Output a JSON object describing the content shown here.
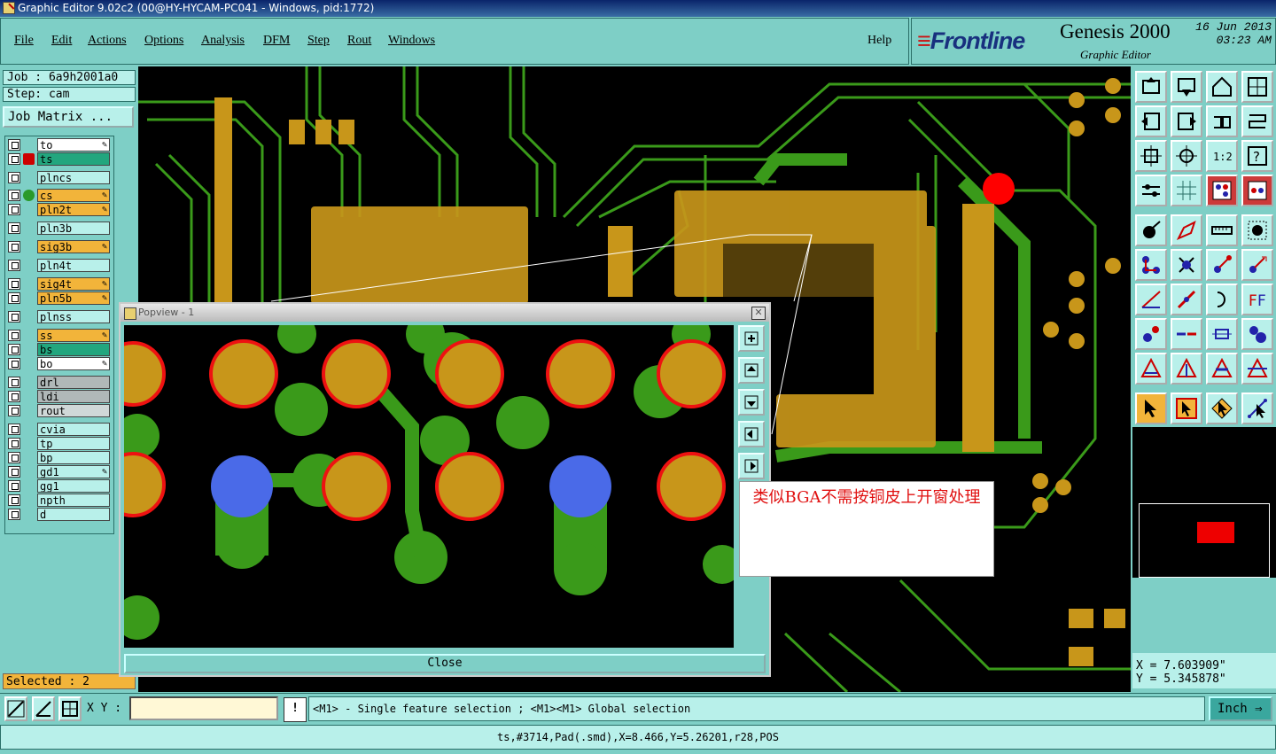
{
  "window": {
    "title": "Graphic Editor 9.02c2 (00@HY-HYCAM-PC041 - Windows, pid:1772)"
  },
  "menu": {
    "items": [
      "File",
      "Edit",
      "Actions",
      "Options",
      "Analysis",
      "DFM",
      "Step",
      "Rout",
      "Windows"
    ],
    "help": "Help"
  },
  "brand": {
    "logo": "Frontline",
    "product": "Genesis 2000",
    "subtitle": "Graphic Editor",
    "date": "16 Jun 2013",
    "time": "03:23 AM"
  },
  "job": {
    "job_label": "Job : 6a9h2001a0",
    "step_label": "Step: cam",
    "matrix_button": "Job Matrix ..."
  },
  "layers": [
    {
      "name": "to",
      "color": "#ffffff"
    },
    {
      "name": "ts",
      "color": "#22a67e"
    },
    {
      "name": "plncs",
      "color": "#b8f0ea"
    },
    {
      "name": "cs",
      "color": "#f2b43a"
    },
    {
      "name": "pln2t",
      "color": "#f2b43a"
    },
    {
      "name": "pln3b",
      "color": "#b8f0ea"
    },
    {
      "name": "sig3b",
      "color": "#f2b43a"
    },
    {
      "name": "pln4t",
      "color": "#b8f0ea"
    },
    {
      "name": "sig4t",
      "color": "#f2b43a"
    },
    {
      "name": "pln5b",
      "color": "#f2b43a"
    },
    {
      "name": "plnss",
      "color": "#b8f0ea"
    },
    {
      "name": "ss",
      "color": "#f2b43a"
    },
    {
      "name": "bs",
      "color": "#22a67e"
    },
    {
      "name": "bo",
      "color": "#ffffff"
    },
    {
      "name": "drl",
      "color": "#b0b8b8"
    },
    {
      "name": "ldi",
      "color": "#b0b8b8"
    },
    {
      "name": "rout",
      "color": "#d0d8d8"
    },
    {
      "name": "cvia",
      "color": "#b8f0ea"
    },
    {
      "name": "tp",
      "color": "#b8f0ea"
    },
    {
      "name": "bp",
      "color": "#b8f0ea"
    },
    {
      "name": "gd1",
      "color": "#b8f0ea"
    },
    {
      "name": "gg1",
      "color": "#b8f0ea"
    },
    {
      "name": "npth",
      "color": "#b8f0ea"
    },
    {
      "name": "d",
      "color": "#b8f0ea"
    }
  ],
  "selection": {
    "label": "Selected : 2"
  },
  "popview": {
    "title": "Popview - 1",
    "close_label": "Close"
  },
  "annotation": {
    "text": "类似BGA不需按铜皮上开窗处理"
  },
  "coords": {
    "x": "X = 7.603909\"",
    "y": "Y = 5.345878\""
  },
  "bottom": {
    "xy_label": "X Y :",
    "xy_value": "",
    "warn_label": "!",
    "hint": "<M1> - Single feature selection ; <M1><M1> Global selection",
    "unit": "Inch"
  },
  "status": {
    "text": "ts,#3714,Pad(.smd),X=8.466,Y=5.26201,r28,POS"
  },
  "colors": {
    "pad": "#c8961a",
    "trace": "#3a9a1a",
    "outline": "#ee1111",
    "via": "#4a6ae8",
    "highlight": "#ff0000"
  }
}
